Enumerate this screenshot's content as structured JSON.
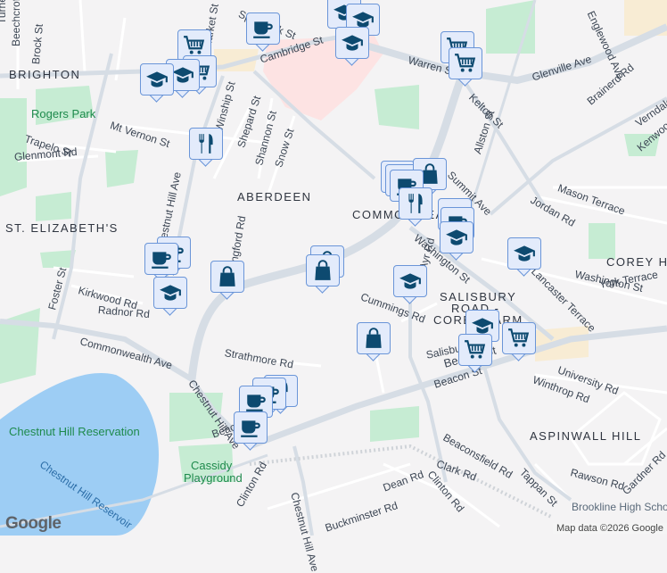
{
  "map": {
    "neighborhoods": [
      "BRIGHTON",
      "ABERDEEN",
      "ST. ELIZABETH'S",
      "COMMONWEALTH",
      "SALISBURY",
      "ROAD -",
      "COREY FARM",
      "COREY HILL",
      "ASPINWALL HILL"
    ],
    "parks": [
      "Rogers Park",
      "Chestnut Hill Reservation",
      "Cassidy",
      "Playground"
    ],
    "water": [
      "Chestnut Hill Reservoir"
    ],
    "places": [
      "Brookline High School"
    ],
    "streets": [
      "Turner St",
      "Beechcroft St",
      "Brock St",
      "Chestnut Hill Ave",
      "Cambridge St",
      "Warren St",
      "Kelton St",
      "Allston St",
      "Glenville Ave",
      "Brainerd Rd",
      "Verndale St",
      "Kenwood St",
      "Mt Vernon St",
      "Trapelo St",
      "Glenmont Rd",
      "Winship St",
      "Shepard St",
      "Shannon St",
      "Snow St",
      "Summit Ave",
      "Mason Terrace",
      "Jordan Rd",
      "Washington St",
      "Lancaster Terrace",
      "York Terrace",
      "Cummings Rd",
      "Salisbury Rd",
      "Beacon St",
      "Kirkwood Rd",
      "Radnor Rd",
      "Foster St",
      "Commonwealth Ave",
      "Strathmore Rd",
      "Chestnut Hill Ave",
      "University Rd",
      "Winthrop Rd",
      "Beaconsfield Rd",
      "Clark Rd",
      "Tappan St",
      "Rawson Rd",
      "Gardner Rd",
      "Dean Rd",
      "Clinton Rd",
      "Buckminster Rd",
      "Chestnut Hill Ave",
      "Clinton Rd",
      "Sparhawk St",
      "Market St",
      "Langford Rd",
      "Ayr Rd",
      "Englewood Ave"
    ],
    "markers": [
      "school",
      "school",
      "school",
      "coffee",
      "cart",
      "cart",
      "school",
      "school",
      "cart",
      "cart",
      "restaurant",
      "coffee",
      "coffee",
      "bag",
      "coffee",
      "restaurant",
      "coffee",
      "coffee",
      "school",
      "school",
      "coffee",
      "coffee",
      "bag",
      "bag",
      "bag",
      "school",
      "school",
      "bag",
      "school",
      "cart",
      "cart",
      "restaurant",
      "coffee",
      "coffee",
      "coffee"
    ]
  },
  "footer": {
    "logo": "Google",
    "attribution": "Map data ©2026 Google"
  }
}
